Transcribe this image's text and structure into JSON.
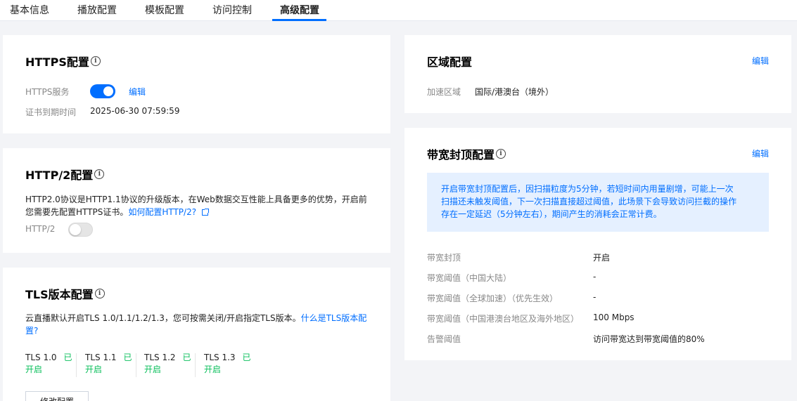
{
  "tabs": [
    "基本信息",
    "播放配置",
    "模板配置",
    "访问控制",
    "高级配置"
  ],
  "https": {
    "title": "HTTPS配置",
    "service_label": "HTTPS服务",
    "edit_label": "编辑",
    "cert_expiry_label": "证书到期时间",
    "cert_expiry_value": "2025-06-30 07:59:59",
    "enabled": true
  },
  "http2": {
    "title": "HTTP/2配置",
    "desc_line1": "HTTP2.0协议是HTTP1.1协议的升级版本，在Web数据交互性能上具备更多的优势，开启前",
    "desc_line2": "您需要先配置HTTPS证书。",
    "link": "如何配置HTTP/2?",
    "toggle_label": "HTTP/2",
    "enabled": false
  },
  "tls": {
    "title": "TLS版本配置",
    "desc": "云直播默认开启TLS 1.0/1.1/1.2/1.3，您可按需关闭/开启指定TLS版本。",
    "link_line1": "什么是TLS版本配",
    "link_line2": "置?",
    "versions": [
      {
        "name": "TLS 1.0",
        "status_a": "已",
        "status_b": "开启"
      },
      {
        "name": "TLS 1.1",
        "status_a": "已",
        "status_b": "开启"
      },
      {
        "name": "TLS 1.2",
        "status_a": "已",
        "status_b": "开启"
      },
      {
        "name": "TLS 1.3",
        "status_a": "已",
        "status_b": "开启"
      }
    ],
    "modify_button": "修改配置"
  },
  "region": {
    "title": "区域配置",
    "edit_label": "编辑",
    "area_label": "加速区域",
    "area_value": "国际/港澳台（境外）"
  },
  "bandwidth": {
    "title": "带宽封顶配置",
    "edit_label": "编辑",
    "notice_line1": "开启带宽封顶配置后，因扫描粒度为5分钟，若短时间内用量剧增，可能上一次",
    "notice_line2": "扫描还未触发阈值，下一次扫描直接超过阈值，此场景下会导致访问拦截的操作",
    "notice_line3": "存在一定延迟（5分钟左右），期间产生的消耗会正常计费。",
    "rows": [
      {
        "label": "带宽封顶",
        "value": "开启"
      },
      {
        "label": "带宽阈值（中国大陆）",
        "value": "-"
      },
      {
        "label": "带宽阈值（全球加速）（优先生效）",
        "value": "-"
      },
      {
        "label": "带宽阈值（中国港澳台地区及海外地区）",
        "value": "100 Mbps"
      },
      {
        "label": "告警阈值",
        "value": "访问带宽达到带宽阈值的80%"
      }
    ]
  },
  "colors": {
    "accent": "#006eff",
    "success": "#0abf5b",
    "notice_bg": "#e5f0ff"
  }
}
